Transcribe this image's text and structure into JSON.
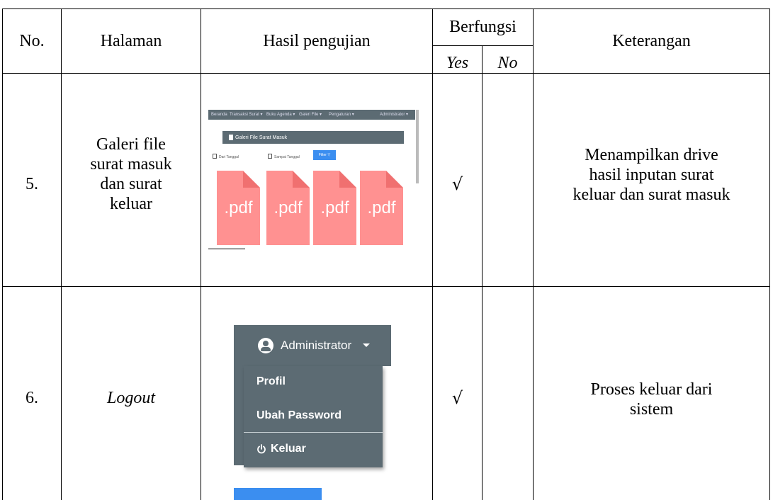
{
  "table": {
    "headers": {
      "no": "No.",
      "halaman": "Halaman",
      "hasil": "Hasil pengujian",
      "berfungsi": "Berfungsi",
      "yes": "Yes",
      "no_col": "No",
      "keterangan": "Keterangan"
    },
    "rows": [
      {
        "no": "5.",
        "halaman_lines": [
          "Galeri file",
          "surat masuk",
          "dan surat",
          "keluar"
        ],
        "yes": "√",
        "no_mark": "",
        "keterangan_lines": [
          "Menampilkan drive",
          "hasil inputan surat",
          "keluar dan surat masuk"
        ]
      },
      {
        "no": "6.",
        "halaman": "Logout",
        "yes": "√",
        "no_mark": "",
        "keterangan_lines": [
          "Proses keluar dari",
          "sistem"
        ]
      }
    ]
  },
  "screenshot1": {
    "nav_items": [
      "Beranda",
      "Transaksi Surat ▾",
      "Buku Agenda ▾",
      "Galeri File ▾",
      "Pengaturan ▾"
    ],
    "user": "Administrator ▾",
    "panel_title": "Galeri File Surat Masuk",
    "date_from": "Dari Tanggal",
    "date_to": "Sampai Tanggal",
    "filter_button": "Filter ▽",
    "files": [
      ".pdf",
      ".pdf",
      ".pdf",
      ".pdf"
    ],
    "colors": {
      "nav": "#5c6b73",
      "pdf": "#ff9191",
      "pdf_corner": "#f07070",
      "button": "#3b8ef0"
    }
  },
  "screenshot2": {
    "user": "Administrator",
    "menu": [
      "Profil",
      "Ubah Password",
      "Keluar"
    ],
    "icons": {
      "user": "user-circle-icon",
      "caret": "caret-down-icon",
      "logout": "power-icon"
    },
    "colors": {
      "menu_bg": "#5c6b73",
      "accent": "#3b8ef0"
    }
  }
}
